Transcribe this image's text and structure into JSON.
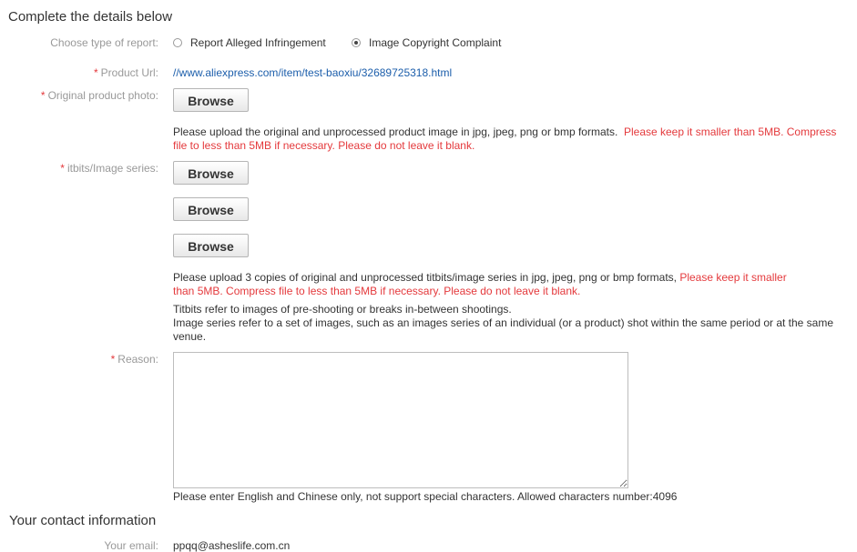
{
  "details_section": {
    "title": "Complete the details below"
  },
  "report_type": {
    "label": "Choose type of report:",
    "options": [
      {
        "label": "Report Alleged Infringement",
        "selected": false
      },
      {
        "label": "Image Copyright Complaint",
        "selected": true
      }
    ]
  },
  "product_url": {
    "label": "Product Url:",
    "value": "//www.aliexpress.com/item/test-baoxiu/32689725318.html"
  },
  "original_photo": {
    "label": "Original product photo:",
    "browse_label": "Browse",
    "help": "Please upload the original and unprocessed product image in jpg, jpeg, png or bmp formats.",
    "help_warning": "Please keep it smaller than 5MB. Compress file to less than 5MB if necessary. Please do not leave it blank."
  },
  "titbits": {
    "label": "itbits/Image series:",
    "browse_labels": [
      "Browse",
      "Browse",
      "Browse"
    ],
    "help": "Please upload 3 copies of original and unprocessed titbits/image series in jpg, jpeg, png or bmp formats,",
    "help_warning": "Please keep it smaller than 5MB. Compress file to less than 5MB if necessary. Please do not leave it blank.",
    "note_1": "Titbits refer to images of pre-shooting or breaks in-between shootings.",
    "note_2": "Image series refer to a set of images, such as an images series of an individual (or a product) shot within the same period or at the same venue."
  },
  "reason": {
    "label": "Reason:",
    "value": "",
    "help": "Please enter English and Chinese only, not support special characters. Allowed characters number:4096"
  },
  "contact_section": {
    "title": "Your contact information"
  },
  "email": {
    "label": "Your email:",
    "value": "ppqq@asheslife.com.cn"
  },
  "colors": {
    "required_star": "#e4393c",
    "link": "#1c5eab",
    "warning": "#e4393c",
    "label": "#999999"
  }
}
